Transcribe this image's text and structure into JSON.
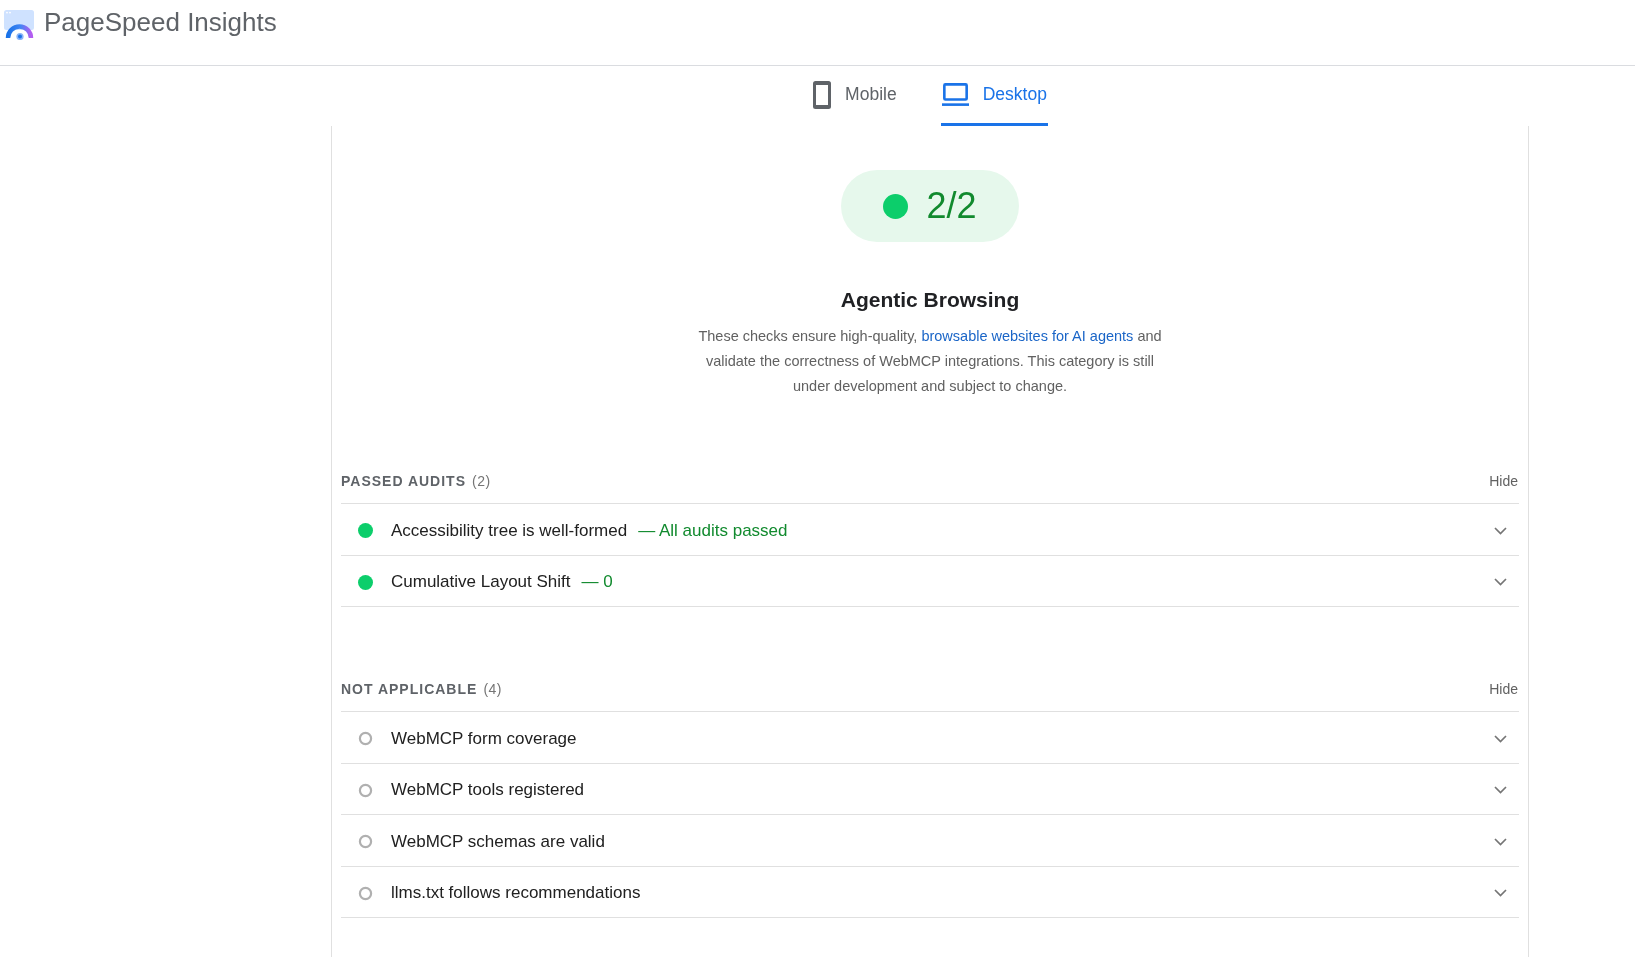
{
  "header": {
    "title": "PageSpeed Insights"
  },
  "tabs": [
    {
      "label": "Mobile",
      "kind": "phone",
      "selected": false
    },
    {
      "label": "Desktop",
      "kind": "laptop",
      "selected": true
    }
  ],
  "score": {
    "value": "2/2",
    "passed": true
  },
  "category": {
    "title": "Agentic Browsing",
    "description": [
      {
        "text": "These checks ensure high-quality, ",
        "kind": "text"
      },
      {
        "text": "browsable websites for AI agents",
        "kind": "link"
      },
      {
        "text": " and validate the correctness of WebMCP integrations. This category is still under development and subject to change.",
        "kind": "text"
      }
    ]
  },
  "sections": [
    {
      "title": "PASSED AUDITS",
      "count": "(2)",
      "toggle": "Hide",
      "audits": [
        {
          "title": "Accessibility tree is well-formed",
          "display_value": "— All audits passed",
          "kind": "passed",
          "expanded": false
        },
        {
          "title": "Cumulative Layout Shift",
          "display_value": "— 0",
          "kind": "passed",
          "expanded": false
        }
      ]
    },
    {
      "title": "NOT APPLICABLE",
      "count": "(4)",
      "toggle": "Hide",
      "audits": [
        {
          "title": "WebMCP form coverage",
          "kind": "skipped",
          "expanded": false
        },
        {
          "title": "WebMCP tools registered",
          "kind": "skipped",
          "expanded": false
        },
        {
          "title": "WebMCP schemas are valid",
          "kind": "skipped",
          "expanded": false
        },
        {
          "title": "llms.txt follows recommendations",
          "kind": "skipped",
          "expanded": false
        }
      ]
    }
  ]
}
